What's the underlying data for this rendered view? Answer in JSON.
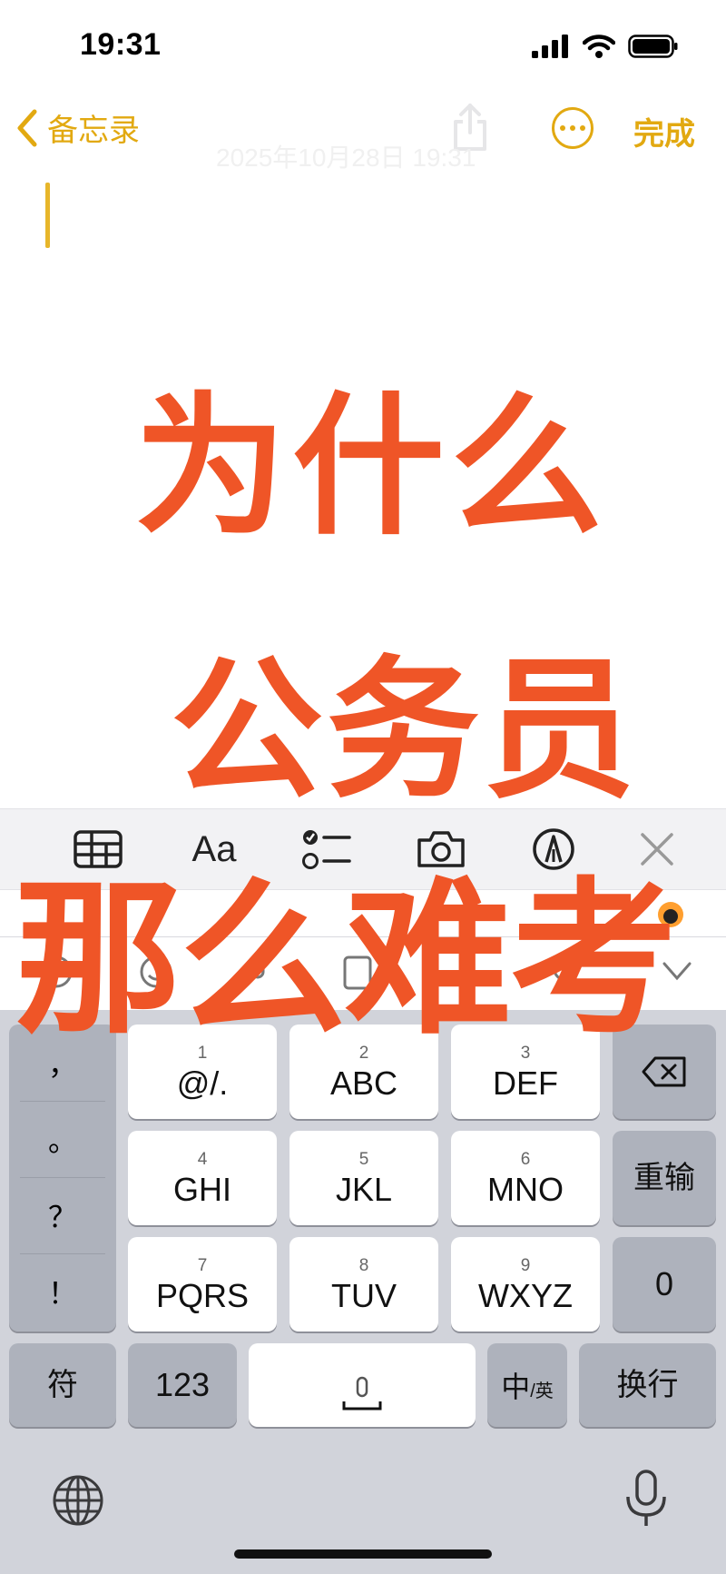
{
  "status_bar": {
    "time": "19:31"
  },
  "nav": {
    "back_label": "备忘录",
    "done_label": "完成"
  },
  "note": {
    "date": "2025年10月28日 19:31"
  },
  "format_toolbar": {
    "text_style_label": "Aa"
  },
  "keyboard": {
    "punctuation": [
      "，",
      "。",
      "？",
      "！"
    ],
    "rows": [
      [
        {
          "num": "1",
          "label": "@/."
        },
        {
          "num": "2",
          "label": "ABC"
        },
        {
          "num": "3",
          "label": "DEF"
        }
      ],
      [
        {
          "num": "4",
          "label": "GHI"
        },
        {
          "num": "5",
          "label": "JKL"
        },
        {
          "num": "6",
          "label": "MNO"
        }
      ],
      [
        {
          "num": "7",
          "label": "PQRS"
        },
        {
          "num": "8",
          "label": "TUV"
        },
        {
          "num": "9",
          "label": "WXYZ"
        }
      ]
    ],
    "retype_label": "重输",
    "zero_label": "0",
    "symbols_label": "符",
    "numbers_label": "123",
    "lang_main": "中",
    "lang_sub": "/英",
    "return_label": "换行"
  },
  "overlay_text": {
    "line1": "为什么",
    "line2": "公务员",
    "line3": "那么难考"
  },
  "colors": {
    "accent": "#e2a911",
    "overlay": "#ef5527",
    "keyboard_bg": "#d1d3da"
  }
}
